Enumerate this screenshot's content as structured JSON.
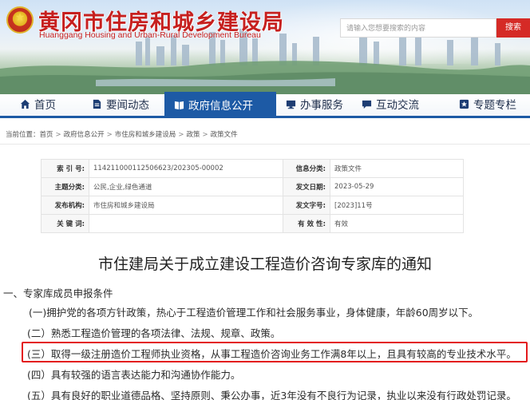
{
  "header": {
    "site_title": "黄冈市住房和城乡建设局",
    "site_subtitle": "Huanggang Housing and Urban-Rural Development Bureau",
    "search_placeholder": "请输入您想要搜索的内容",
    "search_button": "搜索",
    "brand_color": "#c6201f"
  },
  "nav": {
    "items": [
      {
        "label": "首页",
        "icon": "home-icon"
      },
      {
        "label": "要闻动态",
        "icon": "document-icon"
      },
      {
        "label": "政府信息公开",
        "icon": "book-icon",
        "active": true
      },
      {
        "label": "办事服务",
        "icon": "monitor-icon"
      },
      {
        "label": "互动交流",
        "icon": "chat-icon"
      },
      {
        "label": "专题专栏",
        "icon": "star-square-icon"
      }
    ],
    "active_color": "#1d5aa5"
  },
  "breadcrumb": {
    "prefix": "当前位置：",
    "items": [
      "首页",
      "政府信息公开",
      "市住房和城乡建设局",
      "政策",
      "政策文件"
    ],
    "separator": ">"
  },
  "info": {
    "index_label": "索 引 号:",
    "index_value": "114211000112506623/202305-00002",
    "category_label": "信息分类:",
    "category_value": "政策文件",
    "topic_label": "主题分类:",
    "topic_value": "公民,企业,绿色通道",
    "date_label": "发文日期:",
    "date_value": "2023-05-29",
    "org_label": "发布机构:",
    "org_value": "市住房和城乡建设局",
    "docno_label": "发文字号:",
    "docno_value": "[2023]11号",
    "keyword_label": "关 键 词:",
    "keyword_value": "",
    "validity_label": "有 效 性:",
    "validity_value": "有效"
  },
  "article": {
    "title": "市住建局关于成立建设工程造价咨询专家库的通知",
    "section_heading": "一、专家库成员申报条件",
    "paragraphs": [
      "(一)拥护党的各项方针政策，热心于工程造价管理工作和社会服务事业，身体健康，年龄60周岁以下。",
      "(二）熟悉工程造价管理的各项法律、法规、规章、政策。",
      "(三）取得一级注册造价工程师执业资格，从事工程造价咨询业务工作满8年以上，且具有较高的专业技术水平。",
      "(四）具有较强的语言表达能力和沟通协作能力。",
      "(五）具有良好的职业道德品格、坚持原则、秉公办事，近3年没有不良行为记录，执业以来没有行政处罚记录。"
    ],
    "highlight_color": "#e3191c"
  }
}
